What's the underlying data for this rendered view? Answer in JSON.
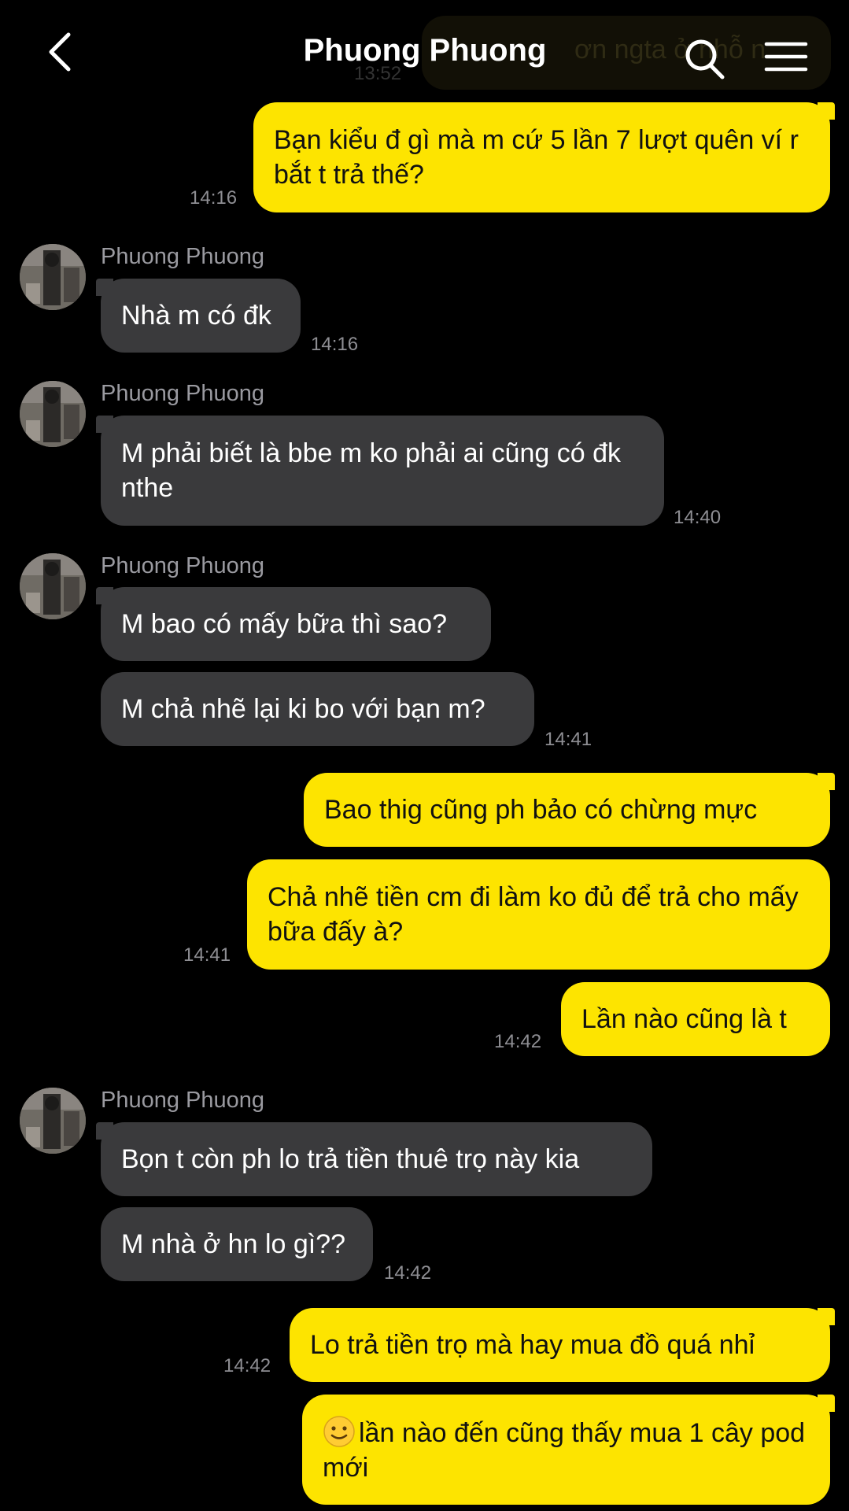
{
  "header": {
    "title": "Phuong Phuong",
    "ghost_text": "ơn ngta ở nhỗ n",
    "ghost_time": "13:52"
  },
  "contact_name": "Phuong Phuong",
  "messages": [
    {
      "side": "out",
      "text": "Bạn kiểu đ gì mà m cứ 5 lần 7 lượt quên ví r bắt t trả thế?",
      "time": "14:16"
    },
    {
      "side": "in",
      "text": "Nhà m có đk",
      "time": "14:16"
    },
    {
      "side": "in",
      "text": "M phải biết là bbe m ko phải ai cũng có đk nthe",
      "time": "14:40"
    },
    {
      "side": "in",
      "text": "M bao có mấy bữa thì sao?"
    },
    {
      "side": "in",
      "text": "M chả nhẽ lại ki bo với bạn m?",
      "time": "14:41"
    },
    {
      "side": "out",
      "text": "Bao thig cũng ph bảo có chừng mực"
    },
    {
      "side": "out",
      "text": "Chả nhẽ tiền cm đi làm ko đủ để trả cho mấy bữa đấy à?",
      "time": "14:41"
    },
    {
      "side": "out",
      "text": "Lần nào cũng là t",
      "time": "14:42"
    },
    {
      "side": "in",
      "text": "Bọn t còn ph lo trả tiền thuê trọ này kia"
    },
    {
      "side": "in",
      "text": "M nhà ở hn lo gì??",
      "time": "14:42"
    },
    {
      "side": "out",
      "text": "Lo trả tiền trọ mà hay mua đồ quá nhỉ",
      "time": "14:42"
    },
    {
      "side": "out",
      "text": "lần nào đến cũng thấy mua 1 cây pod mới",
      "emoji": "slightly-smiling-face"
    }
  ],
  "colors": {
    "background": "#000000",
    "incoming_bubble": "#3a3a3c",
    "outgoing_bubble": "#fde400",
    "timestamp": "#8e8e93",
    "sender_name": "#9a9aa0"
  },
  "icons": {
    "back": "chevron-left-icon",
    "search": "search-icon",
    "menu": "hamburger-menu-icon"
  }
}
